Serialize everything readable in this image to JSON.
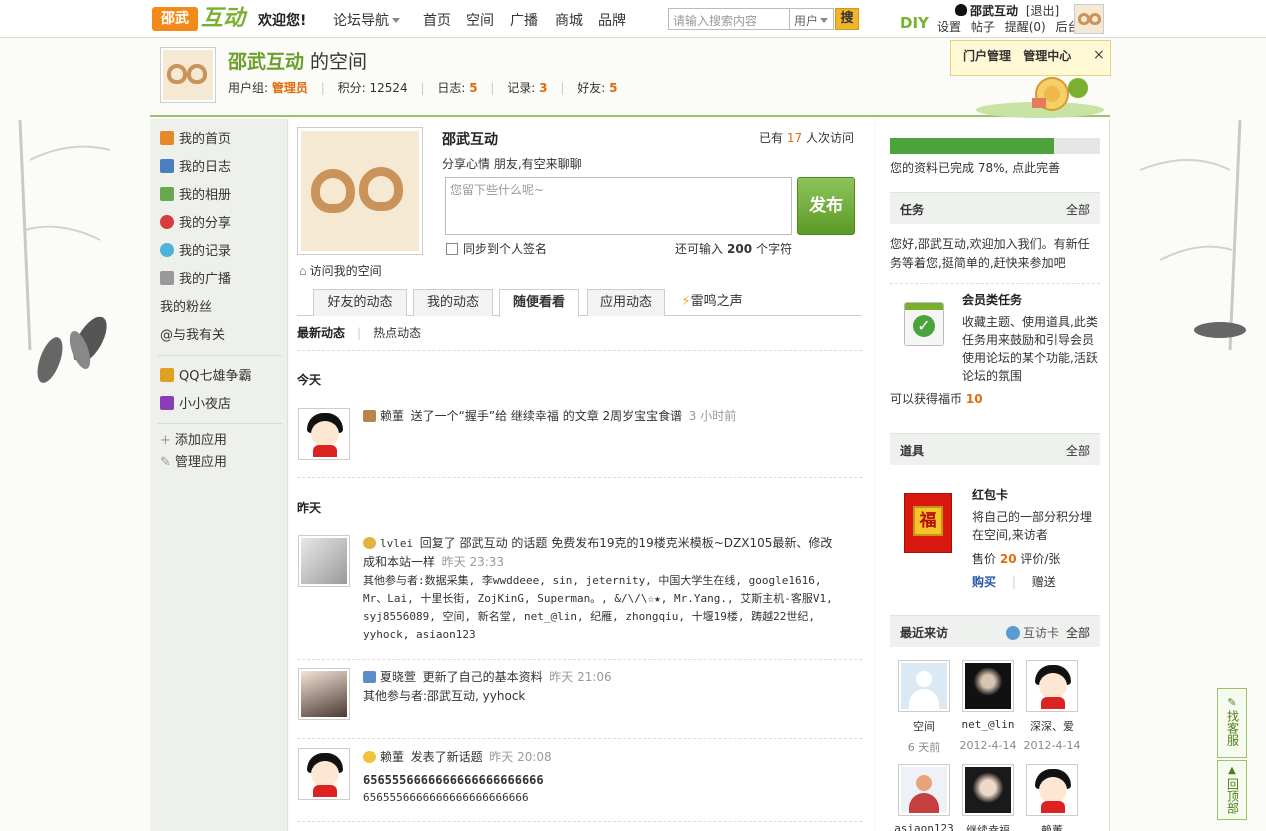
{
  "topbar": {
    "logo_left": "邵武",
    "logo_right": "互动",
    "welcome": "欢迎您!",
    "nav_guide": "论坛导航",
    "nav": [
      "首页",
      "空间",
      "广播",
      "商城",
      "品牌"
    ],
    "search_placeholder": "请输入搜索内容",
    "search_type": "用户",
    "search_button": "搜",
    "diy": "DIY",
    "username": "邵武互动",
    "logout": "[退出]",
    "links": [
      "设置",
      "帖子",
      "提醒(0)",
      "后台"
    ]
  },
  "header": {
    "space_owner": "邵武互动",
    "space_suffix": " 的空间",
    "usergroup_label": "用户组:",
    "usergroup": "管理员",
    "credits_label": "积分:",
    "credits": "12524",
    "blogs_label": "日志:",
    "blogs": "5",
    "records_label": "记录:",
    "records": "3",
    "friends_label": "好友:",
    "friends": "5"
  },
  "popup": {
    "portal_admin": "门户管理",
    "admin_center": "管理中心",
    "close": "×"
  },
  "sidebar": {
    "items": [
      {
        "label": "我的首页",
        "icon": "home-icon",
        "color": "#e58a2c"
      },
      {
        "label": "我的日志",
        "icon": "blog-icon",
        "color": "#4b7fc0"
      },
      {
        "label": "我的相册",
        "icon": "album-icon",
        "color": "#6aa84f"
      },
      {
        "label": "我的分享",
        "icon": "share-icon",
        "color": "#d63c3c"
      },
      {
        "label": "我的记录",
        "icon": "record-icon",
        "color": "#4fb3d9"
      },
      {
        "label": "我的广播",
        "icon": "broadcast-icon",
        "color": "#999999"
      },
      {
        "label": "我的粉丝",
        "icon": "",
        "color": ""
      },
      {
        "label": "@与我有关",
        "icon": "",
        "color": ""
      }
    ],
    "apps": [
      {
        "label": "QQ七雄争霸",
        "icon": "qq-game-icon",
        "color": "#e0a020"
      },
      {
        "label": "小小夜店",
        "icon": "nightclub-icon",
        "color": "#8a3fb8"
      }
    ],
    "add_app": "添加应用",
    "manage_app": "管理应用"
  },
  "main": {
    "name": "邵武互动",
    "visits_prefix": "已有",
    "visits": "17",
    "visits_suffix": "人次访问",
    "motto": "分享心情 朋友,有空来聊聊",
    "input_placeholder": "您留下些什么呢~",
    "publish": "发布",
    "sync_label": "同步到个人签名",
    "remain_prefix": "还可输入",
    "remain_count": "200",
    "remain_suffix": "个字符",
    "visit_my_space": "访问我的空间",
    "tabs": [
      "好友的动态",
      "我的动态",
      "随便看看",
      "应用动态",
      "雷鸣之声"
    ],
    "subtabs": [
      "最新动态",
      "热点动态"
    ],
    "today": "今天",
    "yesterday": "昨天",
    "feeds": [
      {
        "user": "赖董",
        "action": "送了一个“握手”给 继续幸福 的文章 2周岁宝宝食谱",
        "time": "3 小时前"
      },
      {
        "user": "lvlei",
        "action": "回复了 邵武互动 的话题 免费发布19克的19楼克米模板~DZX105最新、修改成和本站一样",
        "time": "昨天 23:33",
        "others": "其他参与者:数据采集, 李wwddeee, sin, jeternity, 中国大学生在线, google1616, Mr、Lai, 十里长街, ZojKinG, Superman。, &/\\/\\☆★, Mr.Yang., 艾斯主机-客服V1, syj8556089, 空间, 新名堂, net_@lin, 纪雁, zhongqiu, 十堰19楼, 踌越22世纪, yyhock, asiaon123"
      },
      {
        "user": "夏晓萱",
        "action": "更新了自己的基本资料",
        "time": "昨天 21:06",
        "others": "其他参与者:邵武互动, yyhock"
      },
      {
        "user": "赖董",
        "action": "发表了新话题",
        "time": "昨天 20:08",
        "title": "6565556666666666666666666",
        "body": "6565556666666666666666666"
      }
    ]
  },
  "right": {
    "profile_progress": 0.78,
    "profile_text": "您的资料已完成 78%, 点此完善",
    "task_title": "任务",
    "all": "全部",
    "task_text": "您好,邵武互动,欢迎加入我们。有新任务等着您,挺简单的,赶快来参加吧",
    "member_task_title": "会员类任务",
    "member_task_desc": "收藏主题、使用道具,此类任务用来鼓励和引导会员使用论坛的某个功能,活跃论坛的氛围",
    "reward_prefix": "可以获得福币",
    "reward": "10",
    "props_title": "道具",
    "red_card_title": "红包卡",
    "fu_char": "福",
    "red_card_desc": "将自己的一部分积分埋在空间,来访者",
    "price_prefix": "售价",
    "price": "20",
    "price_suffix": "评价/张",
    "buy": "购买",
    "gift": "赠送",
    "visitors_title": "最近来访",
    "visit_card": "互访卡",
    "visitors": [
      {
        "name": "空间",
        "time": "6 天前"
      },
      {
        "name": "net_@lin",
        "time": "2012-4-14"
      },
      {
        "name": "深深、爱",
        "time": "2012-4-14"
      },
      {
        "name": "asiaon123",
        "time": ""
      },
      {
        "name": "继续幸福",
        "time": ""
      },
      {
        "name": "赖董",
        "time": ""
      }
    ]
  },
  "float": {
    "service": "找客服",
    "top": "回顶部"
  }
}
